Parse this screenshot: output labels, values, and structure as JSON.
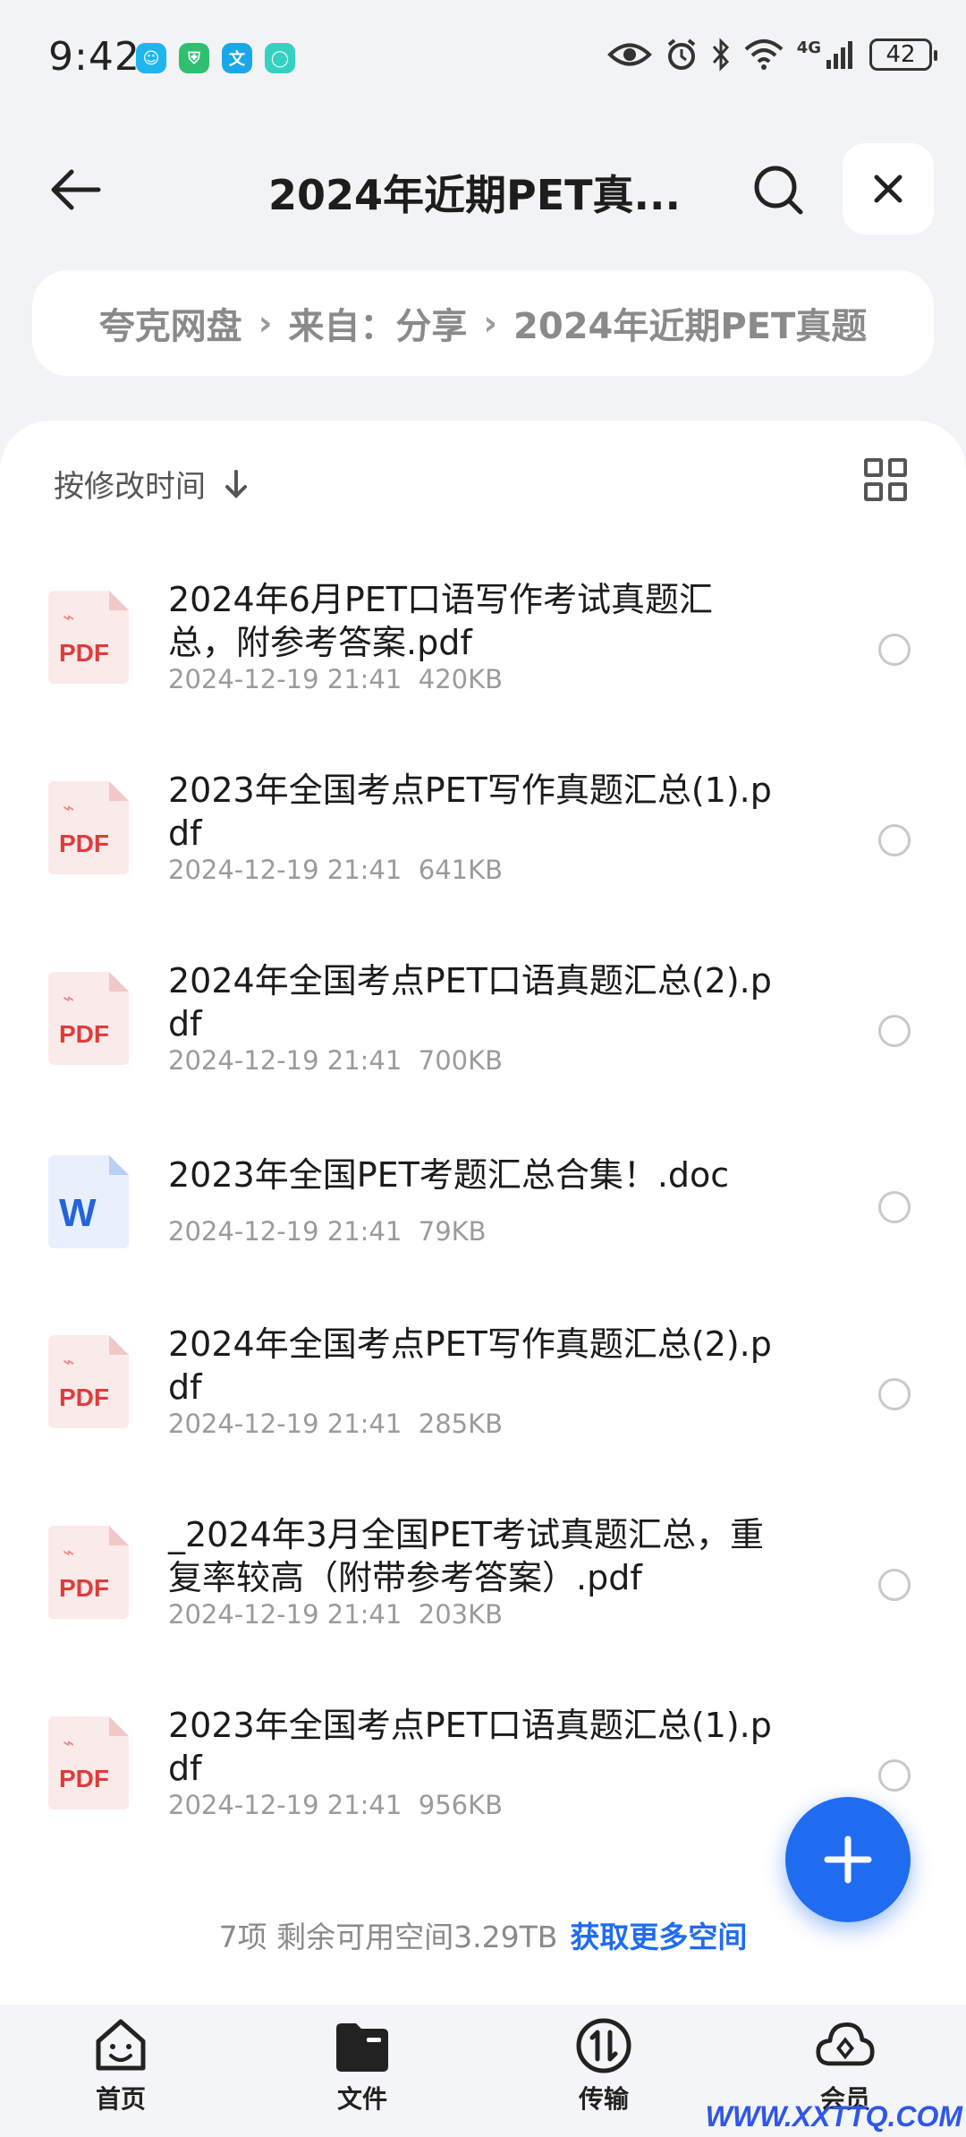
{
  "status_bar": {
    "time": "9:42",
    "network": "4G",
    "battery": "42"
  },
  "header": {
    "title": "2024年近期PET真..."
  },
  "breadcrumb": {
    "items": [
      "夸克网盘",
      "来自：分享",
      "2024年近期PET真题"
    ]
  },
  "sort": {
    "label": "按修改时间"
  },
  "files": [
    {
      "name": "2024年6月PET口语写作考试真题汇总，附参考答案.pdf",
      "date": "2024-12-19 21:41",
      "size": "420KB",
      "type": "pdf"
    },
    {
      "name": "2023年全国考点PET写作真题汇总(1).pdf",
      "date": "2024-12-19 21:41",
      "size": "641KB",
      "type": "pdf"
    },
    {
      "name": "2024年全国考点PET口语真题汇总(2).pdf",
      "date": "2024-12-19 21:41",
      "size": "700KB",
      "type": "pdf"
    },
    {
      "name": "2023年全国PET考题汇总合集！.doc",
      "date": "2024-12-19 21:41",
      "size": "79KB",
      "type": "doc"
    },
    {
      "name": "2024年全国考点PET写作真题汇总(2).pdf",
      "date": "2024-12-19 21:41",
      "size": "285KB",
      "type": "pdf"
    },
    {
      "name": "_2024年3月全国PET考试真题汇总，重复率较高（附带参考答案）.pdf",
      "date": "2024-12-19 21:41",
      "size": "203KB",
      "type": "pdf"
    },
    {
      "name": "2023年全国考点PET口语真题汇总(1).pdf",
      "date": "2024-12-19 21:41",
      "size": "956KB",
      "type": "pdf"
    }
  ],
  "footer": {
    "info": "7项 剩余可用空间3.29TB",
    "link": "获取更多空间"
  },
  "nav": {
    "home": "首页",
    "files": "文件",
    "transfer": "传输",
    "member": "会员"
  },
  "icons": {
    "pdf_label": "PDF",
    "doc_label": "W"
  },
  "watermark": "WWW.XXTTQ.COM",
  "colors": {
    "accent": "#1f6cf0",
    "pdf": "#e03b3b",
    "doc": "#2563d8"
  }
}
